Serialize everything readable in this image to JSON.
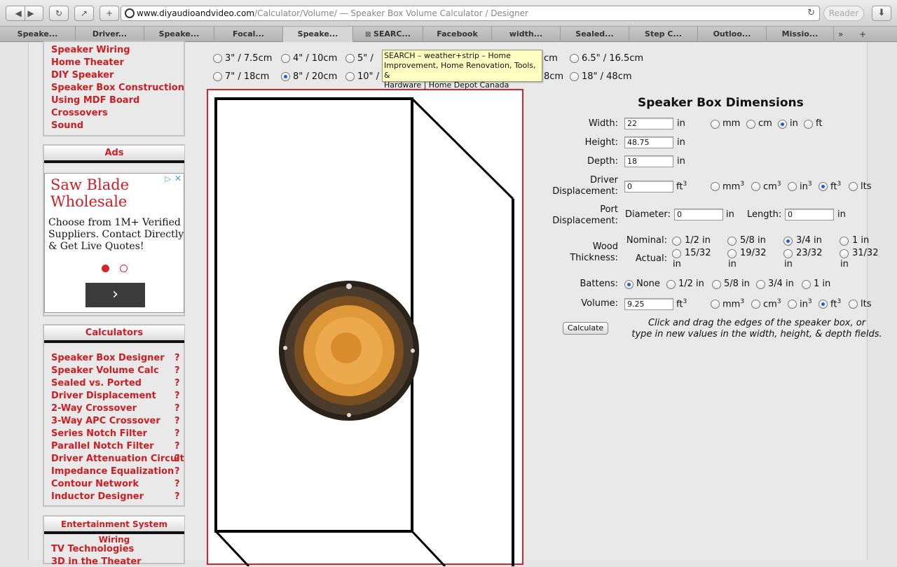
{
  "browser": {
    "url_domain": "www.diyaudioandvideo.com",
    "url_path": "/Calculator/Volume/",
    "page_title": "— Speaker Box Volume Calculator / Designer",
    "reader_label": "Reader",
    "tabs": [
      "Speake...",
      "Driver...",
      "Speake...",
      "Focal...",
      "Speake...",
      "SEARC...",
      "Facebook",
      "width...",
      "Sealed...",
      "Step C...",
      "Outloo...",
      "Missio..."
    ],
    "more_tabs": "»",
    "new_tab": "+"
  },
  "sidebar": {
    "top_links": [
      "Speaker Wiring",
      "Home Theater",
      "DIY Speaker",
      "Speaker Box Construction",
      "Using MDF Board",
      "Crossovers",
      "Sound"
    ],
    "ads_title": "Ads",
    "ad": {
      "headline_line1": "Saw Blade",
      "headline_line2": "Wholesale",
      "body_line1": "Choose from 1M+ Verified",
      "body_line2": "Suppliers. Contact Directly",
      "body_line3": "& Get Live Quotes!",
      "next_arrow": "›"
    },
    "calculators_title": "Calculators",
    "calculators": [
      "Speaker Box Designer",
      "Speaker Volume Calc",
      "Sealed vs. Ported",
      "Driver Displacement",
      "2-Way Crossover",
      "3-Way APC Crossover",
      "Series Notch Filter",
      "Parallel Notch Filter",
      "Driver Attenuation Circuit",
      "Impedance Equalization",
      "Contour Network",
      "Inductor Designer"
    ],
    "help_mark": "?",
    "entertainment_title": "Entertainment System Wiring",
    "entertainment_links": [
      "TV Technologies",
      "3D in the Theater"
    ]
  },
  "driver_sizes": {
    "row1": [
      "3\" / 7.5cm",
      "4\" / 10cm",
      "5\" /",
      "6.5\" / 16.5cm"
    ],
    "row1_partial": "cm",
    "row2": [
      "7\" / 18cm",
      "8\" / 20cm",
      "10\" /",
      "18\" / 48cm"
    ],
    "row2_partial": "8cm",
    "selected": "8\" / 20cm"
  },
  "tooltip": {
    "line1": "SEARCH – weather+strip – Home",
    "line2": "Improvement, Home Renovation, Tools, &",
    "line3": "Hardware | Home Depot Canada"
  },
  "dimensions": {
    "title": "Speaker Box Dimensions",
    "width_label": "Width:",
    "width_value": "22",
    "height_label": "Height:",
    "height_value": "48.75",
    "depth_label": "Depth:",
    "depth_value": "18",
    "unit_in": "in",
    "length_units": [
      "mm",
      "cm",
      "in",
      "ft"
    ],
    "length_unit_selected": "in",
    "driver_label_1": "Driver",
    "driver_label_2": "Displacement:",
    "driver_value": "0",
    "unit_ft": "ft",
    "unit_cube": "3",
    "volume_units": [
      "mm",
      "cm",
      "in",
      "ft",
      "lts"
    ],
    "volume_unit_selected": "ft",
    "port_label_1": "Port",
    "port_label_2": "Displacement:",
    "diameter_label": "Diameter:",
    "diameter_value": "0",
    "length_label": "Length:",
    "length_value": "0",
    "wood_label_1": "Wood",
    "wood_label_2": "Thickness:",
    "nominal_label": "Nominal:",
    "nominal_options": [
      "1/2 in",
      "5/8 in",
      "3/4 in",
      "1 in"
    ],
    "nominal_selected": "3/4 in",
    "actual_label": "Actual:",
    "actual_options": [
      "15/32",
      "19/32",
      "23/32",
      "31/32"
    ],
    "battens_label": "Battens:",
    "battens_options": [
      "None",
      "1/2 in",
      "5/8 in",
      "3/4 in",
      "1 in"
    ],
    "battens_selected": "None",
    "volume_label": "Volume:",
    "volume_value": "9.25",
    "calculate_label": "Calculate",
    "hint_line1": "Click and drag the edges of the speaker box, or",
    "hint_line2": "type in new values in the width, height, & depth fields."
  },
  "colors": {
    "link_red": "#cc1f24",
    "radio_blue": "#1d5fd1",
    "woofer_cone": "#e09a3a"
  }
}
